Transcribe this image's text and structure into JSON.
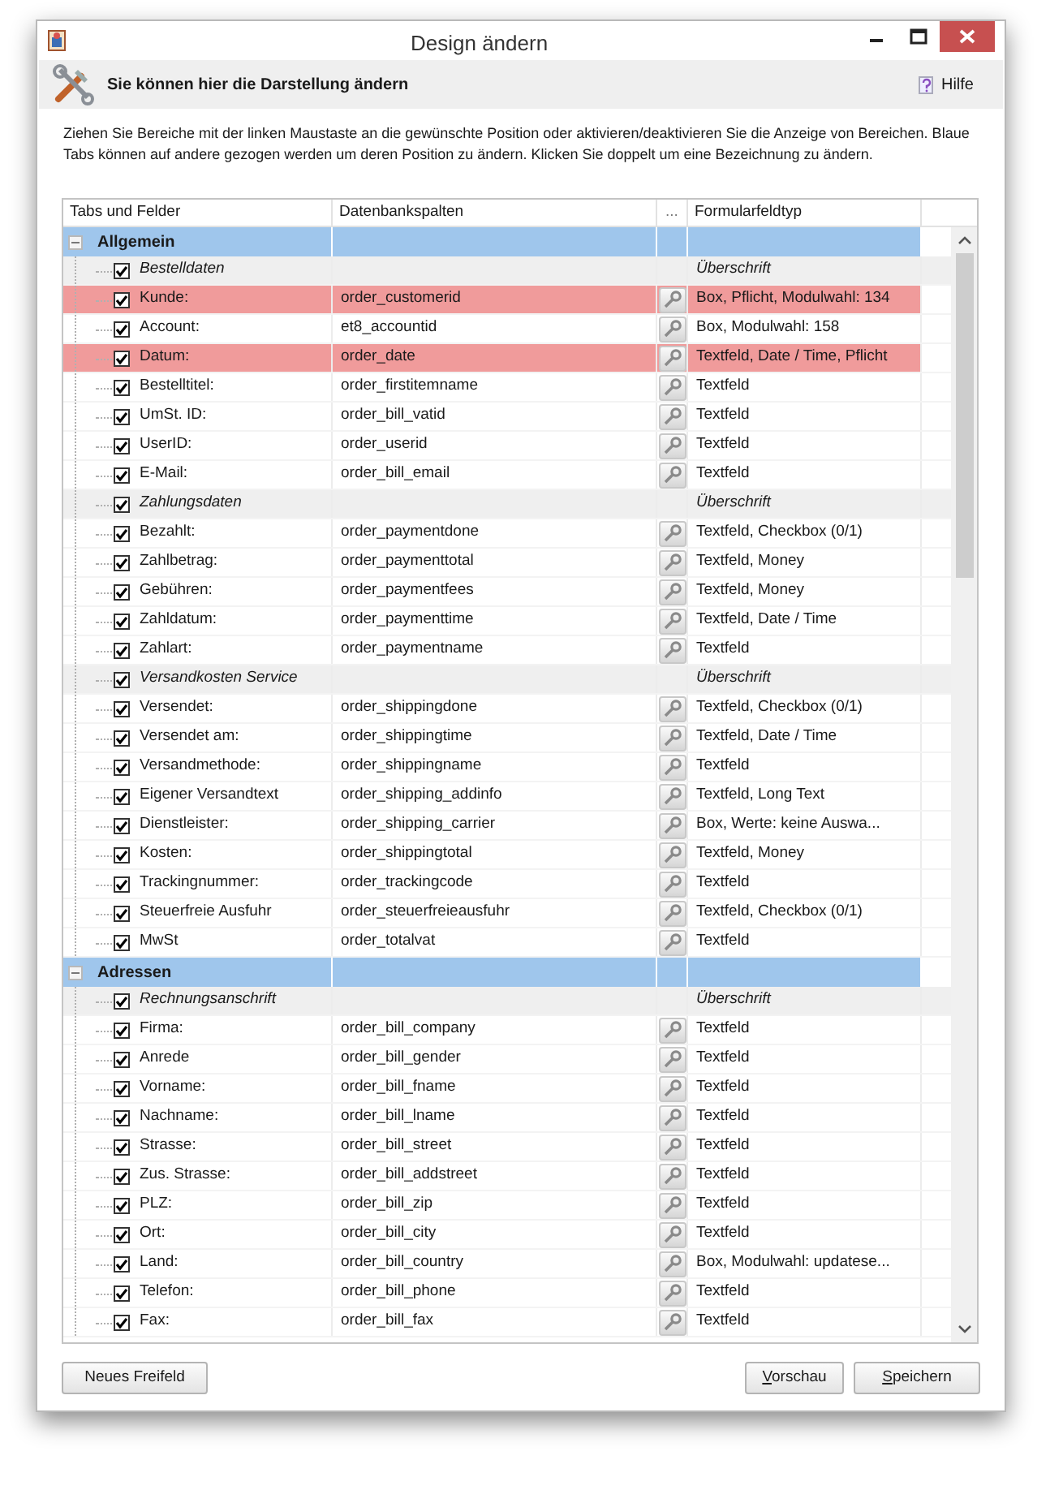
{
  "window": {
    "title": "Design ändern"
  },
  "header": {
    "title": "Sie können hier die Darstellung ändern",
    "help": "Hilfe"
  },
  "description": "Ziehen Sie Bereiche mit der linken Maustaste an die gewünschte Position oder aktivieren/deaktivieren Sie die Anzeige von Bereichen. Blaue Tabs können auf andere gezogen werden um deren Position zu ändern. Klicken Sie doppelt um eine Bezeichnung zu ändern.",
  "table": {
    "columns": [
      "Tabs und Felder",
      "Datenbankspalten",
      "...",
      "Formularfeldtyp"
    ],
    "groups": [
      {
        "name": "Allgemein",
        "expanded": true,
        "children": [
          {
            "kind": "section",
            "name": "Bestelldaten",
            "checked": true,
            "type": "Überschrift"
          },
          {
            "kind": "field",
            "name": "Kunde:",
            "column": "order_customerid",
            "type": "Box, Pflicht, Modulwahl: 134",
            "checked": true,
            "highlighted": true
          },
          {
            "kind": "field",
            "name": "Account:",
            "column": "et8_accountid",
            "type": "Box, Modulwahl: 158",
            "checked": true,
            "highlighted": false
          },
          {
            "kind": "field",
            "name": "Datum:",
            "column": "order_date",
            "type": "Textfeld, Date / Time, Pflicht",
            "checked": true,
            "highlighted": true
          },
          {
            "kind": "field",
            "name": "Bestelltitel:",
            "column": "order_firstitemname",
            "type": "Textfeld",
            "checked": true,
            "highlighted": false
          },
          {
            "kind": "field",
            "name": "UmSt. ID:",
            "column": "order_bill_vatid",
            "type": "Textfeld",
            "checked": true,
            "highlighted": false
          },
          {
            "kind": "field",
            "name": "UserID:",
            "column": "order_userid",
            "type": "Textfeld",
            "checked": true,
            "highlighted": false
          },
          {
            "kind": "field",
            "name": "E-Mail:",
            "column": "order_bill_email",
            "type": "Textfeld",
            "checked": true,
            "highlighted": false
          },
          {
            "kind": "section",
            "name": "Zahlungsdaten",
            "checked": true,
            "type": "Überschrift"
          },
          {
            "kind": "field",
            "name": "Bezahlt:",
            "column": "order_paymentdone",
            "type": "Textfeld, Checkbox (0/1)",
            "checked": true,
            "highlighted": false
          },
          {
            "kind": "field",
            "name": "Zahlbetrag:",
            "column": "order_paymenttotal",
            "type": "Textfeld, Money",
            "checked": true,
            "highlighted": false
          },
          {
            "kind": "field",
            "name": "Gebühren:",
            "column": "order_paymentfees",
            "type": "Textfeld, Money",
            "checked": true,
            "highlighted": false
          },
          {
            "kind": "field",
            "name": "Zahldatum:",
            "column": "order_paymenttime",
            "type": "Textfeld, Date / Time",
            "checked": true,
            "highlighted": false
          },
          {
            "kind": "field",
            "name": "Zahlart:",
            "column": "order_paymentname",
            "type": "Textfeld",
            "checked": true,
            "highlighted": false
          },
          {
            "kind": "section",
            "name": "Versandkosten Service",
            "checked": true,
            "type": "Überschrift"
          },
          {
            "kind": "field",
            "name": "Versendet:",
            "column": "order_shippingdone",
            "type": "Textfeld, Checkbox (0/1)",
            "checked": true,
            "highlighted": false
          },
          {
            "kind": "field",
            "name": "Versendet am:",
            "column": "order_shippingtime",
            "type": "Textfeld, Date / Time",
            "checked": true,
            "highlighted": false
          },
          {
            "kind": "field",
            "name": "Versandmethode:",
            "column": "order_shippingname",
            "type": "Textfeld",
            "checked": true,
            "highlighted": false
          },
          {
            "kind": "field",
            "name": "Eigener Versandtext",
            "column": "order_shipping_addinfo",
            "type": "Textfeld, Long Text",
            "checked": true,
            "highlighted": false
          },
          {
            "kind": "field",
            "name": "Dienstleister:",
            "column": "order_shipping_carrier",
            "type": "Box, Werte: keine Auswa...",
            "checked": true,
            "highlighted": false
          },
          {
            "kind": "field",
            "name": "Kosten:",
            "column": "order_shippingtotal",
            "type": "Textfeld, Money",
            "checked": true,
            "highlighted": false
          },
          {
            "kind": "field",
            "name": "Trackingnummer:",
            "column": "order_trackingcode",
            "type": "Textfeld",
            "checked": true,
            "highlighted": false
          },
          {
            "kind": "field",
            "name": "Steuerfreie Ausfuhr",
            "column": "order_steuerfreieausfuhr",
            "type": "Textfeld, Checkbox (0/1)",
            "checked": true,
            "highlighted": false
          },
          {
            "kind": "field",
            "name": "MwSt",
            "column": "order_totalvat",
            "type": "Textfeld",
            "checked": true,
            "highlighted": false
          }
        ]
      },
      {
        "name": "Adressen",
        "expanded": true,
        "children": [
          {
            "kind": "section",
            "name": "Rechnungsanschrift",
            "checked": true,
            "type": "Überschrift"
          },
          {
            "kind": "field",
            "name": "Firma:",
            "column": "order_bill_company",
            "type": "Textfeld",
            "checked": true,
            "highlighted": false
          },
          {
            "kind": "field",
            "name": "Anrede",
            "column": "order_bill_gender",
            "type": "Textfeld",
            "checked": true,
            "highlighted": false
          },
          {
            "kind": "field",
            "name": "Vorname:",
            "column": "order_bill_fname",
            "type": "Textfeld",
            "checked": true,
            "highlighted": false
          },
          {
            "kind": "field",
            "name": "Nachname:",
            "column": "order_bill_lname",
            "type": "Textfeld",
            "checked": true,
            "highlighted": false
          },
          {
            "kind": "field",
            "name": "Strasse:",
            "column": "order_bill_street",
            "type": "Textfeld",
            "checked": true,
            "highlighted": false
          },
          {
            "kind": "field",
            "name": "Zus. Strasse:",
            "column": "order_bill_addstreet",
            "type": "Textfeld",
            "checked": true,
            "highlighted": false
          },
          {
            "kind": "field",
            "name": "PLZ:",
            "column": "order_bill_zip",
            "type": "Textfeld",
            "checked": true,
            "highlighted": false
          },
          {
            "kind": "field",
            "name": "Ort:",
            "column": "order_bill_city",
            "type": "Textfeld",
            "checked": true,
            "highlighted": false
          },
          {
            "kind": "field",
            "name": "Land:",
            "column": "order_bill_country",
            "type": "Box, Modulwahl: updatese...",
            "checked": true,
            "highlighted": false
          },
          {
            "kind": "field",
            "name": "Telefon:",
            "column": "order_bill_phone",
            "type": "Textfeld",
            "checked": true,
            "highlighted": false
          },
          {
            "kind": "field",
            "name": "Fax:",
            "column": "order_bill_fax",
            "type": "Textfeld",
            "checked": true,
            "highlighted": false
          }
        ]
      }
    ]
  },
  "buttons": [
    {
      "label": "Neues Freifeld",
      "kind": "left"
    },
    {
      "label": "Vorschau",
      "kind": "right"
    },
    {
      "label": "Speichern",
      "kind": "right"
    }
  ]
}
